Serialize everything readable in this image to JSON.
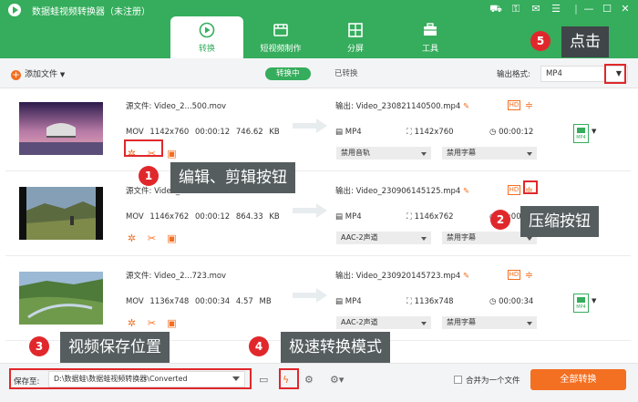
{
  "window": {
    "title": "数据蛙视频转换器（未注册）"
  },
  "nav": {
    "tabs": [
      {
        "label": "转换"
      },
      {
        "label": "短视频制作"
      },
      {
        "label": "分屏"
      },
      {
        "label": "工具"
      }
    ]
  },
  "subbar": {
    "add_label": "添加文件",
    "tab_converting": "转换中",
    "tab_converted": "已转换",
    "format_label": "输出格式:",
    "format_value": "MP4"
  },
  "files": [
    {
      "src": "源文件: Video_2...500.mov",
      "fmt": "MOV",
      "res": "1142x760",
      "dur": "00:00:12",
      "size": "746.62 KB",
      "out": "输出: Video_230821140500.mp4",
      "out_fmt": "MP4",
      "out_res": "1142x760",
      "out_dur": "00:00:12",
      "audio": "禁用音轨",
      "subtitle": "禁用字幕"
    },
    {
      "src": "源文件: Video_2...125.mov",
      "fmt": "MOV",
      "res": "1146x762",
      "dur": "00:00:12",
      "size": "864.33 KB",
      "out": "输出: Video_230906145125.mp4",
      "out_fmt": "MP4",
      "out_res": "1146x762",
      "out_dur": "00:00:12",
      "audio": "AAC-2声道",
      "subtitle": "禁用字幕"
    },
    {
      "src": "源文件: Video_2...723.mov",
      "fmt": "MOV",
      "res": "1136x748",
      "dur": "00:00:34",
      "size": "4.57 MB",
      "out": "输出: Video_230920145723.mp4",
      "out_fmt": "MP4",
      "out_res": "1136x748",
      "out_dur": "00:00:34",
      "audio": "AAC-2声道",
      "subtitle": "禁用字幕"
    }
  ],
  "bottom": {
    "save_label": "保存至:",
    "save_path": "D:\\数据蛙\\数据蛙视频转换器\\Converted",
    "merge_label": "合并为一个文件",
    "convert_all": "全部转换"
  },
  "annotations": [
    {
      "num": "1",
      "text": "编辑、剪辑按钮"
    },
    {
      "num": "2",
      "text": "压缩按钮"
    },
    {
      "num": "3",
      "text": "视频保存位置"
    },
    {
      "num": "4",
      "text": "极速转换模式"
    },
    {
      "num": "5",
      "text": "点击"
    }
  ],
  "colors": {
    "brand": "#35ad5c",
    "accent": "#f36f22",
    "annotation": "#e0282c"
  }
}
